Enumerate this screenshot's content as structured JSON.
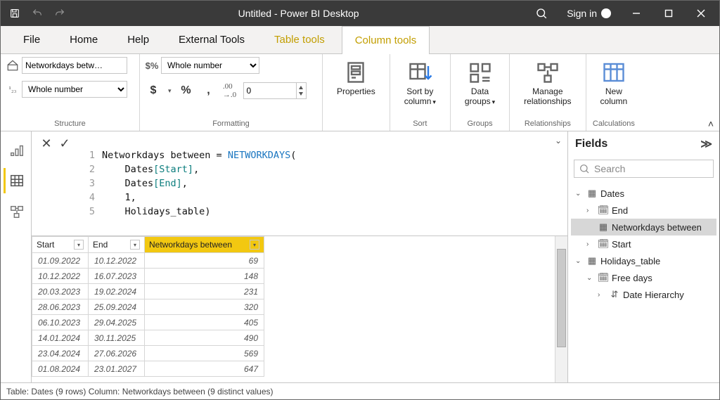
{
  "title": "Untitled - Power BI Desktop",
  "signin_label": "Sign in",
  "tabs": {
    "file": "File",
    "home": "Home",
    "help": "Help",
    "external": "External Tools",
    "table_tools": "Table tools",
    "column_tools": "Column tools"
  },
  "ribbon": {
    "structure": {
      "label": "Structure",
      "name_value": "Networkdays betw…",
      "type_value": "Whole number"
    },
    "formatting": {
      "label": "Formatting",
      "format_value": "Whole number",
      "decimal_value": "0",
      "dollar": "$",
      "percent": "%",
      "comma": ","
    },
    "buttons": {
      "properties": "Properties",
      "sort": "Sort by\ncolumn",
      "groups": "Data\ngroups",
      "relationships": "Manage\nrelationships",
      "new_col": "New\ncolumn"
    },
    "group_labels": {
      "sort": "Sort",
      "groups": "Groups",
      "relationships": "Relationships",
      "calc": "Calculations"
    }
  },
  "formula": {
    "lines": [
      {
        "n": "1",
        "pre": "Networkdays between = ",
        "fn": "NETWORKDAYS",
        "post": "("
      },
      {
        "n": "2",
        "pre": "    Dates",
        "br": "[Start]",
        "post": ","
      },
      {
        "n": "3",
        "pre": "    Dates",
        "br": "[End]",
        "post": ","
      },
      {
        "n": "4",
        "pre": "    ",
        "lit": "1",
        "post": ","
      },
      {
        "n": "5",
        "pre": "    ",
        "ref": "Holidays_table",
        "post": ")"
      }
    ]
  },
  "grid": {
    "headers": {
      "start": "Start",
      "end": "End",
      "nw": "Networkdays between"
    },
    "rows": [
      {
        "start": "01.09.2022",
        "end": "10.12.2022",
        "nw": "69"
      },
      {
        "start": "10.12.2022",
        "end": "16.07.2023",
        "nw": "148"
      },
      {
        "start": "20.03.2023",
        "end": "19.02.2024",
        "nw": "231"
      },
      {
        "start": "28.06.2023",
        "end": "25.09.2024",
        "nw": "320"
      },
      {
        "start": "06.10.2023",
        "end": "29.04.2025",
        "nw": "405"
      },
      {
        "start": "14.01.2024",
        "end": "30.11.2025",
        "nw": "490"
      },
      {
        "start": "23.04.2024",
        "end": "27.06.2026",
        "nw": "569"
      },
      {
        "start": "01.08.2024",
        "end": "23.01.2027",
        "nw": "647"
      }
    ]
  },
  "fields": {
    "title": "Fields",
    "search_placeholder": "Search",
    "tree": {
      "dates": "Dates",
      "end": "End",
      "nw": "Networkdays between",
      "start": "Start",
      "holidays": "Holidays_table",
      "free": "Free days",
      "date_h": "Date Hierarchy"
    }
  },
  "status": "Table: Dates (9 rows) Column: Networkdays between (9 distinct values)"
}
